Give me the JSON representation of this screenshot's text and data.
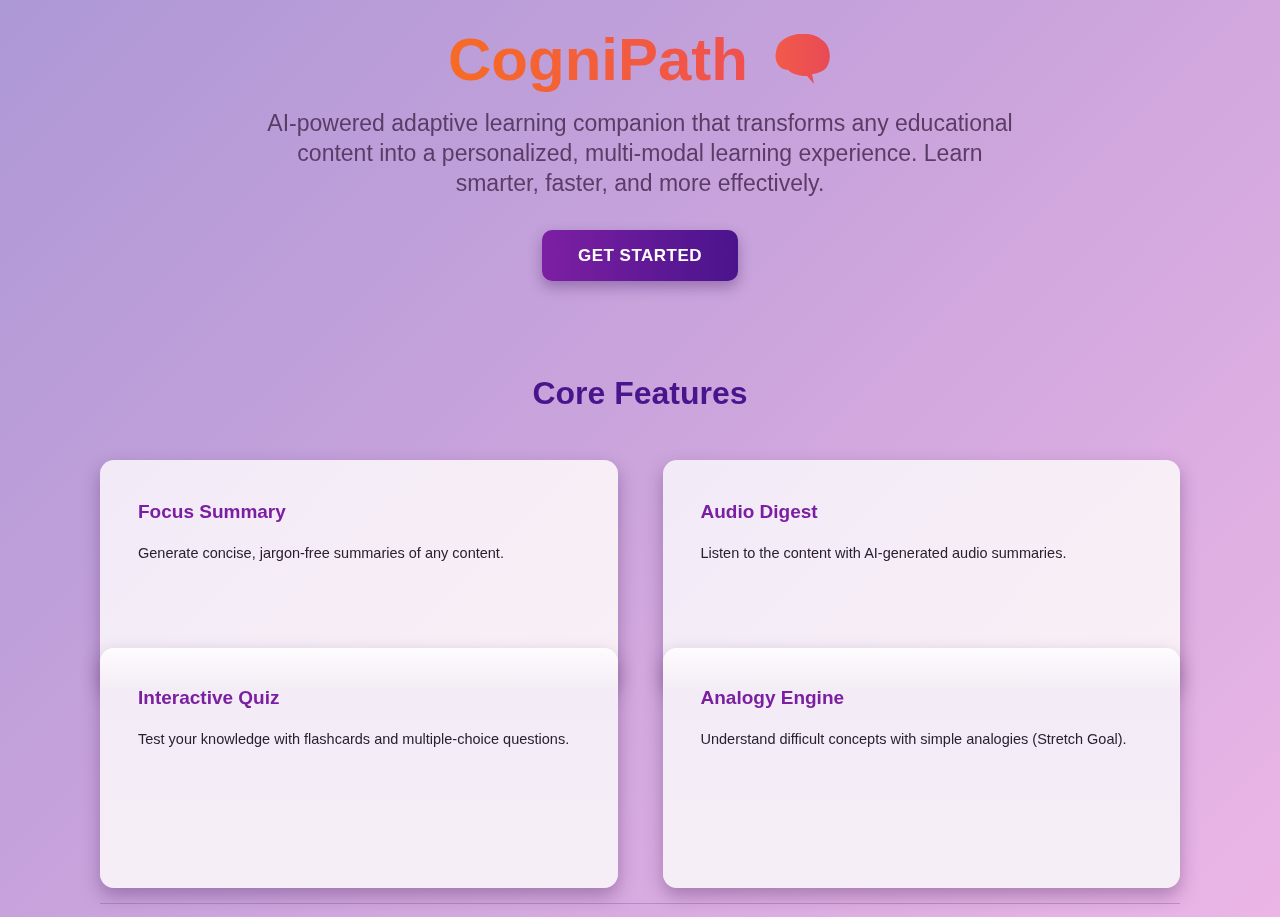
{
  "hero": {
    "title": "CogniPath",
    "subtitle": "AI-powered adaptive learning companion that transforms any educational content into a personalized, multi-modal learning experience. Learn smarter, faster, and more effectively.",
    "button": "GET STARTED"
  },
  "features": {
    "heading": "Core Features",
    "cards": [
      {
        "title": "Focus Summary",
        "description": "Generate concise, jargon-free summaries of any content."
      },
      {
        "title": "Audio Digest",
        "description": "Listen to the content with AI-generated audio summaries."
      },
      {
        "title": "Interactive Quiz",
        "description": "Test your knowledge with flashcards and multiple-choice questions."
      },
      {
        "title": "Analogy Engine",
        "description": "Understand difficult concepts with simple analogies (Stretch Goal)."
      }
    ]
  }
}
